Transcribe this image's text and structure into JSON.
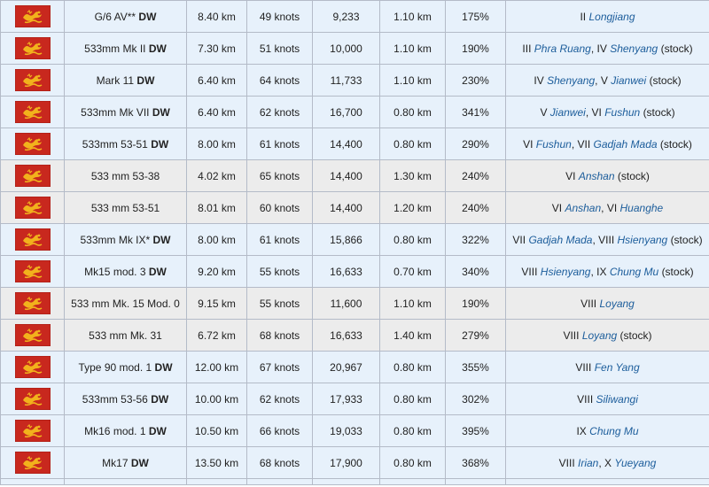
{
  "colors": {
    "link": "#1c5d9b",
    "flag_red": "#c8281e",
    "flag_gold": "#f2b21c",
    "row_blue": "#e7f1fb",
    "row_gray": "#ececec"
  },
  "flag_icon": "pan-asian-dragon-flag-icon",
  "rows": [
    {
      "style": "blue",
      "name": "G/6 AV**",
      "dw": "DW",
      "range": "8.40 km",
      "speed": "49 knots",
      "damage": "9,233",
      "detect": "1.10 km",
      "reload": "175%",
      "ships": [
        {
          "tier": "II",
          "name": "Longjiang",
          "stock": ""
        }
      ]
    },
    {
      "style": "blue",
      "name": "533mm Mk II",
      "dw": "DW",
      "range": "7.30 km",
      "speed": "51 knots",
      "damage": "10,000",
      "detect": "1.10 km",
      "reload": "190%",
      "ships": [
        {
          "tier": "III",
          "name": "Phra Ruang",
          "stock": ""
        },
        {
          "tier": "IV",
          "name": "Shenyang",
          "stock": "(stock)"
        }
      ]
    },
    {
      "style": "blue",
      "name": "Mark 11",
      "dw": "DW",
      "range": "6.40 km",
      "speed": "64 knots",
      "damage": "11,733",
      "detect": "1.10 km",
      "reload": "230%",
      "ships": [
        {
          "tier": "IV",
          "name": "Shenyang",
          "stock": ""
        },
        {
          "tier": "V",
          "name": "Jianwei",
          "stock": "(stock)"
        }
      ]
    },
    {
      "style": "blue",
      "name": "533mm Mk VII",
      "dw": "DW",
      "range": "6.40 km",
      "speed": "62 knots",
      "damage": "16,700",
      "detect": "0.80 km",
      "reload": "341%",
      "ships": [
        {
          "tier": "V",
          "name": "Jianwei",
          "stock": ""
        },
        {
          "tier": "VI",
          "name": "Fushun",
          "stock": "(stock)"
        }
      ]
    },
    {
      "style": "blue",
      "name": "533mm 53-51",
      "dw": "DW",
      "range": "8.00 km",
      "speed": "61 knots",
      "damage": "14,400",
      "detect": "0.80 km",
      "reload": "290%",
      "ships": [
        {
          "tier": "VI",
          "name": "Fushun",
          "stock": ""
        },
        {
          "tier": "VII",
          "name": "Gadjah Mada",
          "stock": "(stock)"
        }
      ]
    },
    {
      "style": "gray",
      "name": "533 mm 53-38",
      "dw": "",
      "range": "4.02 km",
      "speed": "65 knots",
      "damage": "14,400",
      "detect": "1.30 km",
      "reload": "240%",
      "ships": [
        {
          "tier": "VI",
          "name": "Anshan",
          "stock": "(stock)"
        }
      ]
    },
    {
      "style": "gray",
      "name": "533 mm 53-51",
      "dw": "",
      "range": "8.01 km",
      "speed": "60 knots",
      "damage": "14,400",
      "detect": "1.20 km",
      "reload": "240%",
      "ships": [
        {
          "tier": "VI",
          "name": "Anshan",
          "stock": ""
        },
        {
          "tier": "VI",
          "name": "Huanghe",
          "stock": ""
        }
      ]
    },
    {
      "style": "blue",
      "name": "533mm Mk IX*",
      "dw": "DW",
      "range": "8.00 km",
      "speed": "61 knots",
      "damage": "15,866",
      "detect": "0.80 km",
      "reload": "322%",
      "ships": [
        {
          "tier": "VII",
          "name": "Gadjah Mada",
          "stock": ""
        },
        {
          "tier": "VIII",
          "name": "Hsienyang",
          "stock": "(stock)"
        }
      ]
    },
    {
      "style": "blue",
      "name": "Mk15 mod. 3",
      "dw": "DW",
      "range": "9.20 km",
      "speed": "55 knots",
      "damage": "16,633",
      "detect": "0.70 km",
      "reload": "340%",
      "ships": [
        {
          "tier": "VIII",
          "name": "Hsienyang",
          "stock": ""
        },
        {
          "tier": "IX",
          "name": "Chung Mu",
          "stock": "(stock)"
        }
      ]
    },
    {
      "style": "gray",
      "name": "533 mm Mk. 15 Mod. 0",
      "dw": "",
      "range": "9.15 km",
      "speed": "55 knots",
      "damage": "11,600",
      "detect": "1.10 km",
      "reload": "190%",
      "ships": [
        {
          "tier": "VIII",
          "name": "Loyang",
          "stock": ""
        }
      ]
    },
    {
      "style": "gray",
      "name": "533 mm Mk. 31",
      "dw": "",
      "range": "6.72 km",
      "speed": "68 knots",
      "damage": "16,633",
      "detect": "1.40 km",
      "reload": "279%",
      "ships": [
        {
          "tier": "VIII",
          "name": "Loyang",
          "stock": "(stock)"
        }
      ]
    },
    {
      "style": "blue",
      "name": "Type 90 mod. 1",
      "dw": "DW",
      "range": "12.00 km",
      "speed": "67 knots",
      "damage": "20,967",
      "detect": "0.80 km",
      "reload": "355%",
      "ships": [
        {
          "tier": "VIII",
          "name": "Fen Yang",
          "stock": ""
        }
      ]
    },
    {
      "style": "blue",
      "name": "533mm 53-56",
      "dw": "DW",
      "range": "10.00 km",
      "speed": "62 knots",
      "damage": "17,933",
      "detect": "0.80 km",
      "reload": "302%",
      "ships": [
        {
          "tier": "VIII",
          "name": "Siliwangi",
          "stock": ""
        }
      ]
    },
    {
      "style": "blue",
      "name": "Mk16 mod. 1",
      "dw": "DW",
      "range": "10.50 km",
      "speed": "66 knots",
      "damage": "19,033",
      "detect": "0.80 km",
      "reload": "395%",
      "ships": [
        {
          "tier": "IX",
          "name": "Chung Mu",
          "stock": ""
        }
      ]
    },
    {
      "style": "blue",
      "name": "Mk17",
      "dw": "DW",
      "range": "13.50 km",
      "speed": "68 knots",
      "damage": "17,900",
      "detect": "0.80 km",
      "reload": "368%",
      "ships": [
        {
          "tier": "VIII",
          "name": "Irian",
          "stock": ""
        },
        {
          "tier": "X",
          "name": "Yueyang",
          "stock": ""
        }
      ]
    }
  ]
}
